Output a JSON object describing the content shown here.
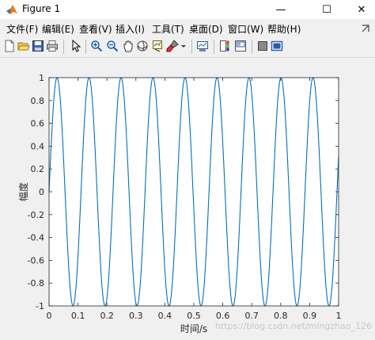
{
  "window": {
    "title": "Figure 1"
  },
  "controls": {
    "minimize": "—",
    "maximize": "☐",
    "close": "✕"
  },
  "menu": [
    {
      "label": "文件(F)"
    },
    {
      "label": "编辑(E)"
    },
    {
      "label": "查看(V)"
    },
    {
      "label": "插入(I)"
    },
    {
      "label": "工具(T)"
    },
    {
      "label": "桌面(D)"
    },
    {
      "label": "窗口(W)"
    },
    {
      "label": "帮助(H)"
    }
  ],
  "menu_dock_icon": "dock-arrow-icon",
  "toolbar": [
    "new-figure-icon",
    "open-file-icon",
    "save-icon",
    "print-icon",
    "pointer-icon",
    "zoom-in-icon",
    "zoom-out-icon",
    "pan-icon",
    "rotate-3d-icon",
    "data-cursor-icon",
    "brush-icon",
    "brush-dropdown-icon",
    "link-plot-icon",
    "colorbar-icon",
    "legend-icon",
    "hide-plot-tools-icon",
    "show-plot-tools-icon"
  ],
  "colors": {
    "line": "#0072BD",
    "axes_bg": "#ffffff",
    "figure_bg": "#f0f0f0"
  },
  "chart_data": {
    "type": "line",
    "xlabel": "时间/s",
    "ylabel": "幅度",
    "xlim": [
      0,
      1
    ],
    "ylim": [
      -1,
      1
    ],
    "x_ticks": [
      "0",
      "0.1",
      "0.2",
      "0.3",
      "0.4",
      "0.5",
      "0.6",
      "0.7",
      "0.8",
      "0.9",
      "1"
    ],
    "y_ticks": [
      "-1",
      "-0.8",
      "-0.6",
      "-0.4",
      "-0.2",
      "0",
      "0.2",
      "0.4",
      "0.6",
      "0.8",
      "1"
    ],
    "series": [
      {
        "function": "sin(2*pi*f*t)",
        "frequency_hz": 9.05,
        "amplitude": 1
      }
    ],
    "grid": false
  },
  "watermark": "https://blog.csdn.net/mingzhao_126"
}
